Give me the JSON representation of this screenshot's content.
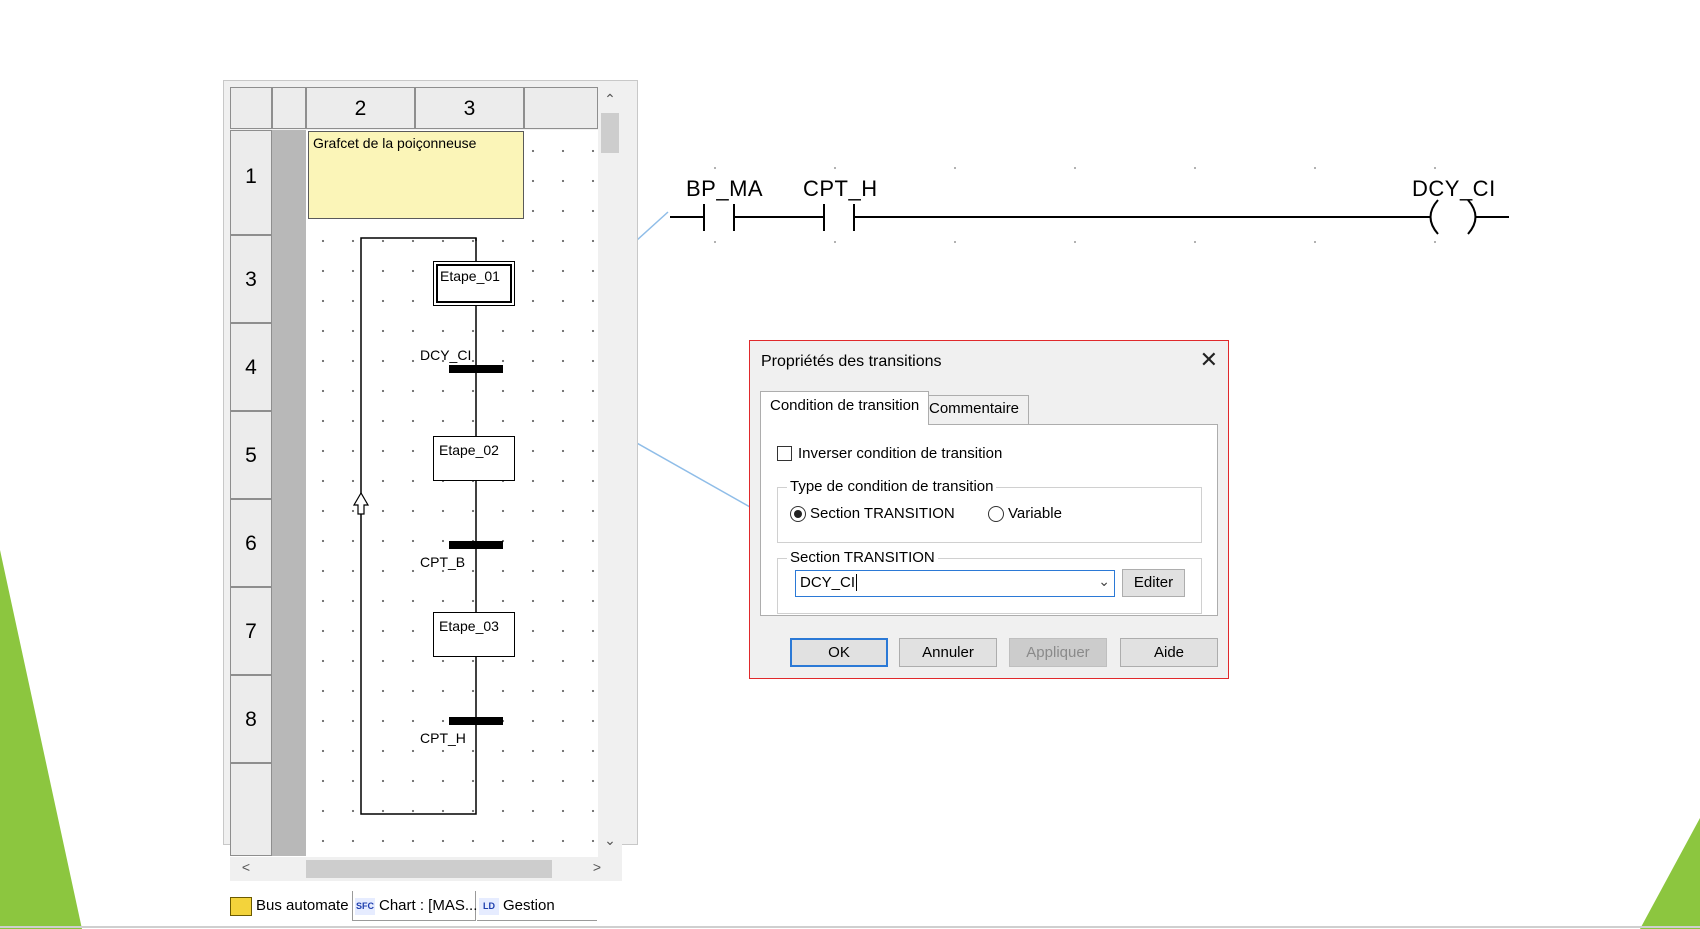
{
  "sfc": {
    "columns": [
      "2",
      "3"
    ],
    "rows": [
      "1",
      "3",
      "4",
      "5",
      "6",
      "7",
      "8"
    ],
    "comment": "Grafcet de la poiçonneuse",
    "steps": [
      "Etape_01",
      "Etape_02",
      "Etape_03"
    ],
    "transitions": [
      "DCY_CI",
      "CPT_B",
      "CPT_H"
    ],
    "scroll": {
      "up": "⌃",
      "down": "⌄",
      "left": "<",
      "right": ">"
    },
    "tabs": [
      {
        "label": "Bus automate",
        "icon": "bus-icon"
      },
      {
        "label": "Chart : [MAS...",
        "icon": "sfc-chart-icon",
        "icon_text": "SFC"
      },
      {
        "label": "Gestion",
        "icon": "ld-icon",
        "icon_text": "LD"
      }
    ]
  },
  "ladder": {
    "contacts": [
      "BP_MA",
      "CPT_H"
    ],
    "coil": "DCY_CI"
  },
  "dialog": {
    "title": "Propriétés des transitions",
    "close": "✕",
    "tabs": [
      "Condition de transition",
      "Commentaire"
    ],
    "invert_label": "Inverser condition de transition",
    "invert_checked": false,
    "type_group": "Type de condition de transition",
    "type_options": [
      "Section TRANSITION",
      "Variable"
    ],
    "type_selected": "Section TRANSITION",
    "section_group": "Section TRANSITION",
    "section_value": "DCY_CI",
    "combo_arrow": "⌄",
    "edit_button": "Editer",
    "buttons": {
      "ok": "OK",
      "cancel": "Annuler",
      "apply": "Appliquer",
      "help": "Aide"
    }
  },
  "colors": {
    "accent_green": "#8cc63f",
    "dialog_border": "#e0292b",
    "comment_fill": "#fbf5b8",
    "arrow": "#8fbde8"
  }
}
